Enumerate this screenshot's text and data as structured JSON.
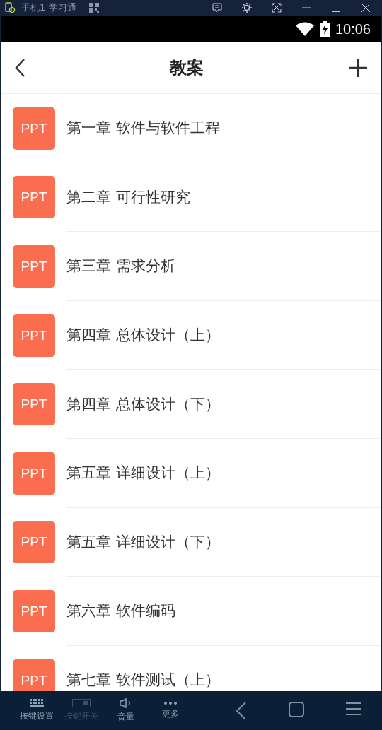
{
  "window": {
    "title": "手机1-学习通"
  },
  "status_bar": {
    "time": "10:06"
  },
  "header": {
    "title": "教案"
  },
  "items": [
    {
      "badge": "PPT",
      "title": "第一章 软件与软件工程"
    },
    {
      "badge": "PPT",
      "title": "第二章 可行性研究"
    },
    {
      "badge": "PPT",
      "title": "第三章 需求分析"
    },
    {
      "badge": "PPT",
      "title": "第四章 总体设计（上）"
    },
    {
      "badge": "PPT",
      "title": "第四章 总体设计（下）"
    },
    {
      "badge": "PPT",
      "title": "第五章 详细设计（上）"
    },
    {
      "badge": "PPT",
      "title": "第五章 详细设计（下）"
    },
    {
      "badge": "PPT",
      "title": "第六章 软件编码"
    },
    {
      "badge": "PPT",
      "title": "第七章 软件测试（上）"
    }
  ],
  "toolbar": [
    {
      "kind": "keyboard",
      "label": "按键设置",
      "disabled": false
    },
    {
      "kind": "toggle",
      "label": "按键开关",
      "disabled": true
    },
    {
      "kind": "volume",
      "label": "音量",
      "disabled": false
    },
    {
      "kind": "more",
      "label": "更多",
      "disabled": false
    }
  ]
}
